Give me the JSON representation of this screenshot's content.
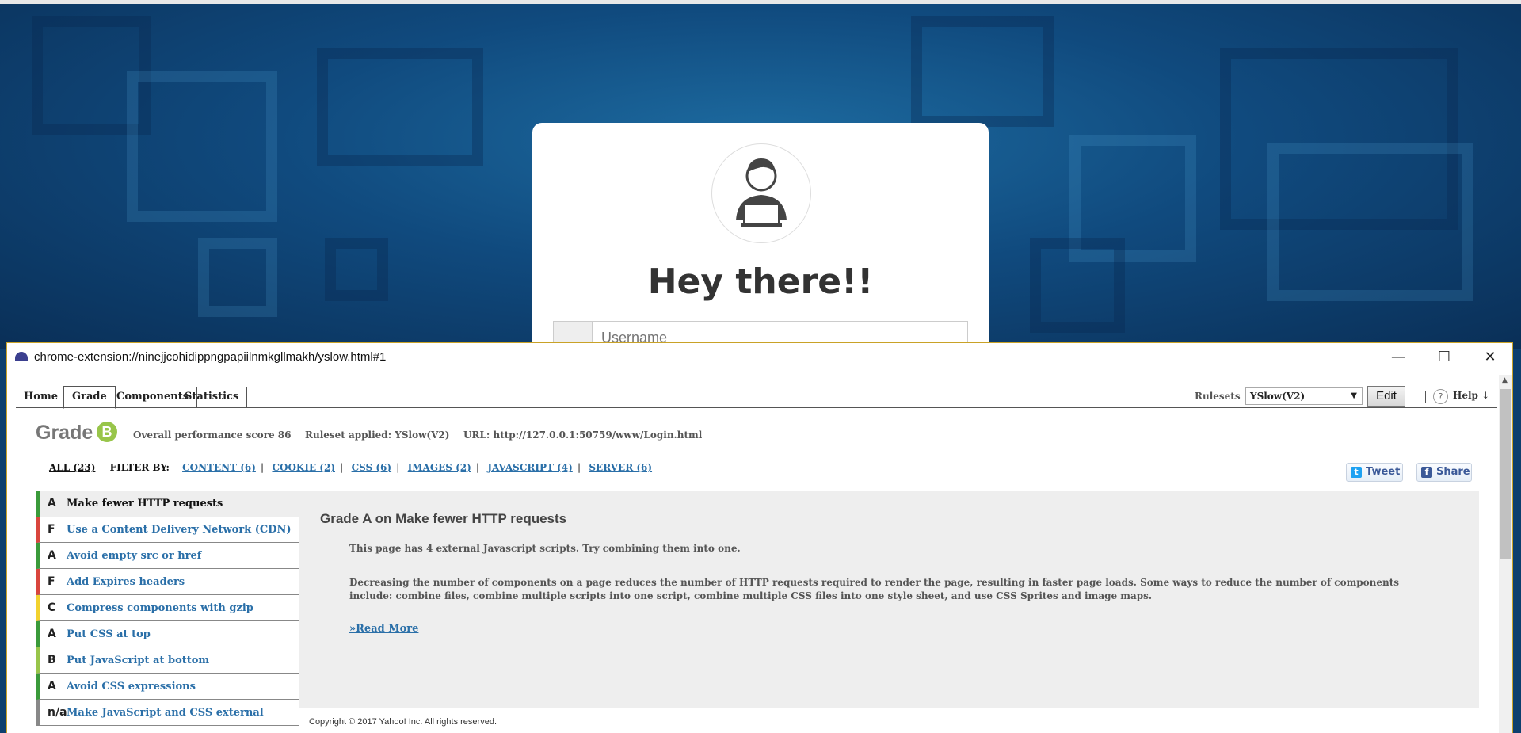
{
  "background_page": {
    "heading": "Hey there!!",
    "username_placeholder": "Username"
  },
  "popup": {
    "title": "chrome-extension://ninejjcohidippngpapiilnmkgllmakh/yslow.html#1",
    "tabs": [
      {
        "label": "Home"
      },
      {
        "label": "Grade",
        "active": true
      },
      {
        "label": "Components"
      },
      {
        "label": "Statistics"
      }
    ],
    "rulesets_label": "Rulesets",
    "ruleset_selected": "YSlow(V2)",
    "edit_label": "Edit",
    "help_q": "?",
    "help_label": "Help ↓",
    "grade": {
      "label": "Grade",
      "letter": "B",
      "score_text": "Overall performance score 86",
      "ruleset_text": "Ruleset applied: YSlow(V2)",
      "url_text": "URL: http://127.0.0.1:50759/www/Login.html"
    },
    "filter": {
      "all": "ALL (23)",
      "filter_by": "FILTER BY:",
      "items": [
        "CONTENT (6)",
        "COOKIE (2)",
        "CSS (6)",
        "IMAGES (2)",
        "JAVASCRIPT (4)",
        "SERVER (6)"
      ]
    },
    "social": {
      "tweet": "Tweet",
      "share": "Share"
    },
    "rules": [
      {
        "grade": "A",
        "name": "Make fewer HTTP requests",
        "color": "#3a9a3a",
        "selected": true
      },
      {
        "grade": "F",
        "name": "Use a Content Delivery Network (CDN)",
        "color": "#d9453d"
      },
      {
        "grade": "A",
        "name": "Avoid empty src or href",
        "color": "#3a9a3a"
      },
      {
        "grade": "F",
        "name": "Add Expires headers",
        "color": "#d9453d"
      },
      {
        "grade": "C",
        "name": "Compress components with gzip",
        "color": "#f2d22e"
      },
      {
        "grade": "A",
        "name": "Put CSS at top",
        "color": "#3a9a3a"
      },
      {
        "grade": "B",
        "name": "Put JavaScript at bottom",
        "color": "#98c54a"
      },
      {
        "grade": "A",
        "name": "Avoid CSS expressions",
        "color": "#3a9a3a"
      },
      {
        "grade": "n/a",
        "name": "Make JavaScript and CSS external",
        "color": "#888888"
      }
    ],
    "detail": {
      "title": "Grade A on Make fewer HTTP requests",
      "message": "This page has 4 external Javascript scripts. Try combining them into one.",
      "description": "Decreasing the number of components on a page reduces the number of HTTP requests required to render the page, resulting in faster page loads. Some ways to reduce the number of components include: combine files, combine multiple scripts into one script, combine multiple CSS files into one style sheet, and use CSS Sprites and image maps.",
      "read_more": "»Read More"
    },
    "copyright": "Copyright © 2017 Yahoo! Inc. All rights reserved.",
    "window_controls": {
      "minimize": "—",
      "maximize": "☐",
      "close": "✕"
    }
  }
}
